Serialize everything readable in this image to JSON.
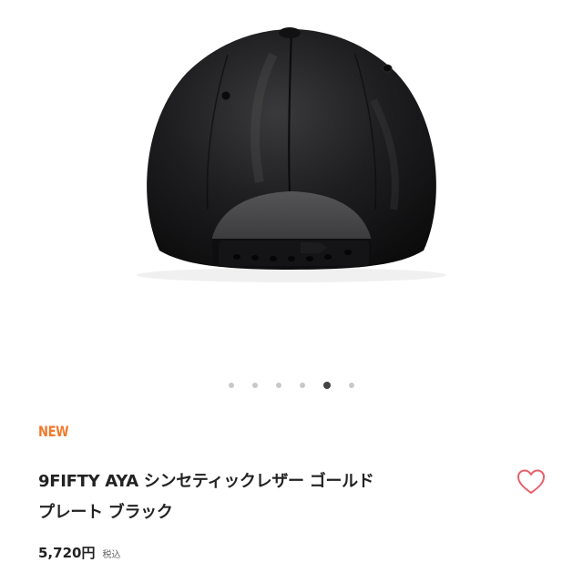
{
  "product": {
    "badge": "NEW",
    "title_line1": "9FIFTY AYA シンセティックレザー ゴールド",
    "title_line2": "プレート ブラック",
    "price": "5,720円",
    "tax_label": "税込"
  },
  "carousel": {
    "total_slides": 6,
    "active_index": 5
  },
  "icons": {
    "like": "heart-outline-icon"
  },
  "colors": {
    "accent": "#f27a2c",
    "heart": "#e8606a",
    "dot_inactive": "#c8c8c8",
    "dot_active": "#444444"
  }
}
